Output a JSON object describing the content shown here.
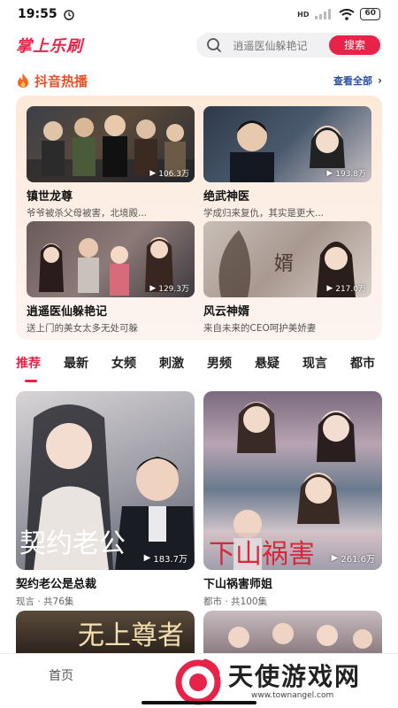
{
  "status_bar": {
    "time": "19:55",
    "network": "HD",
    "battery": "60"
  },
  "header": {
    "app_title": "掌上乐刷",
    "search_placeholder": "逍遥医仙躲艳记",
    "search_button": "搜索"
  },
  "hot": {
    "title": "抖音热播",
    "view_all": "查看全部",
    "items": [
      {
        "name": "镇世龙尊",
        "desc": "爷爷被杀父母被害，北境殿...",
        "views": "106.3万"
      },
      {
        "name": "绝武神医",
        "desc": "学成归来复仇，其实是更大...",
        "views": "193.8万"
      },
      {
        "name": "逍遥医仙躲艳记",
        "desc": "送上门的美女太多无处可躲",
        "views": "129.3万"
      },
      {
        "name": "风云神婿",
        "desc": "来自未来的CEO呵护美娇妻",
        "views": "217.0万"
      }
    ]
  },
  "tabs": [
    "推荐",
    "最新",
    "女频",
    "刺激",
    "男频",
    "悬疑",
    "现言",
    "都市"
  ],
  "grid": [
    {
      "name": "契约老公是总裁",
      "meta": "现言 · 共76集",
      "views": "183.7万",
      "poster_text": "契约老公"
    },
    {
      "name": "下山祸害师姐",
      "meta": "都市 · 共100集",
      "views": "261.6万",
      "poster_text": "下山祸害"
    }
  ],
  "grid_next": [
    {
      "poster_text": "无上尊者"
    },
    {
      "poster_text": ""
    }
  ],
  "bottom_nav": {
    "home": "首页"
  },
  "watermark": {
    "text": "天使游戏网",
    "url": "www.townangel.com"
  },
  "colors": {
    "accent": "#e8234a",
    "hot_title": "#e8522a",
    "view_all": "#2b4fa0"
  },
  "icons": [
    "search-icon",
    "flame-icon",
    "chevron-right-icon",
    "play-icon",
    "wifi-icon",
    "signal-icon",
    "alarm-icon"
  ]
}
